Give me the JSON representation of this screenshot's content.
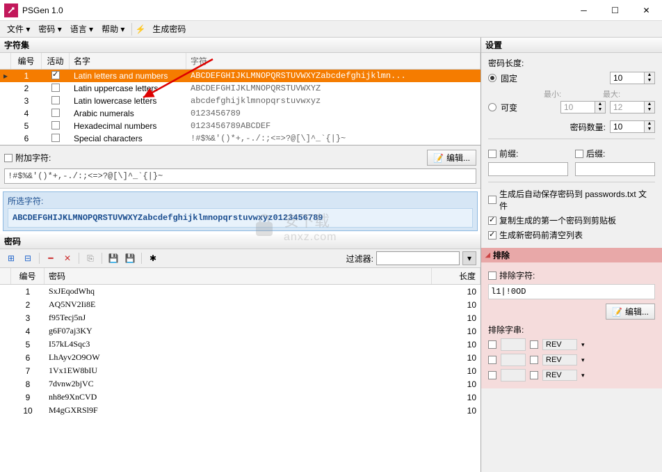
{
  "titlebar": {
    "title": "PSGen 1.0"
  },
  "menu": {
    "file": "文件 ▾",
    "password": "密码 ▾",
    "language": "语言 ▾",
    "help": "帮助 ▾",
    "generate": "生成密码"
  },
  "charset": {
    "header": "字符集",
    "cols": {
      "num": "编号",
      "active": "活动",
      "name": "名字",
      "chars": "字符"
    },
    "rows": [
      {
        "num": "1",
        "active": true,
        "name": "Latin letters and numbers",
        "chars": "ABCDEFGHIJKLMNOPQRSTUVWXYZabcdefghijklmn...",
        "selected": true
      },
      {
        "num": "2",
        "active": false,
        "name": "Latin uppercase letters",
        "chars": "ABCDEFGHIJKLMNOPQRSTUVWXYZ"
      },
      {
        "num": "3",
        "active": false,
        "name": "Latin lowercase letters",
        "chars": "abcdefghijklmnopqrstuvwxyz"
      },
      {
        "num": "4",
        "active": false,
        "name": "Arabic numerals",
        "chars": "0123456789"
      },
      {
        "num": "5",
        "active": false,
        "name": "Hexadecimal numbers",
        "chars": "0123456789ABCDEF"
      },
      {
        "num": "6",
        "active": false,
        "name": "Special characters",
        "chars": "!#$%&'()*+,-./:;<=>?@[\\]^_`{|}~"
      }
    ]
  },
  "append": {
    "label": "附加字符:",
    "edit": "编辑...",
    "value": "!#$%&'()*+,-./:;<=>?@[\\]^_`{|}~"
  },
  "selected": {
    "label": "所选字符:",
    "value": "ABCDEFGHIJKLMNOPQRSTUVWXYZabcdefghijklmnopqrstuvwxyz0123456789"
  },
  "pwd": {
    "header": "密码",
    "filter": "过滤器:",
    "cols": {
      "num": "编号",
      "pwd": "密码",
      "len": "长度"
    },
    "rows": [
      {
        "num": "1",
        "pwd": "SxJEqodWhq",
        "len": "10"
      },
      {
        "num": "2",
        "pwd": "AQ5NV2Ii8E",
        "len": "10"
      },
      {
        "num": "3",
        "pwd": "f95Tecj5nJ",
        "len": "10"
      },
      {
        "num": "4",
        "pwd": "g6F07aj3KY",
        "len": "10"
      },
      {
        "num": "5",
        "pwd": "I57kL4Sqc3",
        "len": "10"
      },
      {
        "num": "6",
        "pwd": "LhAyv2O9OW",
        "len": "10"
      },
      {
        "num": "7",
        "pwd": "1Vx1EW8bIU",
        "len": "10"
      },
      {
        "num": "8",
        "pwd": "7dvnw2bjVC",
        "len": "10"
      },
      {
        "num": "9",
        "pwd": "nh8e9XnCVD",
        "len": "10"
      },
      {
        "num": "10",
        "pwd": "M4gGXRSl9F",
        "len": "10"
      }
    ]
  },
  "settings": {
    "header": "设置",
    "length_label": "密码长度:",
    "fixed": "固定",
    "fixed_val": "10",
    "variable": "可变",
    "min_label": "最小:",
    "min_val": "10",
    "max_label": "最大:",
    "max_val": "12",
    "count_label": "密码数量:",
    "count_val": "10",
    "prefix": "前缀:",
    "suffix": "后缀:",
    "autosave": "生成后自动保存密码到 passwords.txt 文件",
    "copyfirst": "复制生成的第一个密码到剪贴板",
    "clearlist": "生成新密码前清空列表"
  },
  "exclude": {
    "header": "排除",
    "chars_label": "排除字符:",
    "chars_value": "l1|!0OD",
    "edit": "编辑...",
    "strings_label": "排除字串:",
    "rev": "REV"
  },
  "watermark": "anxz.com"
}
